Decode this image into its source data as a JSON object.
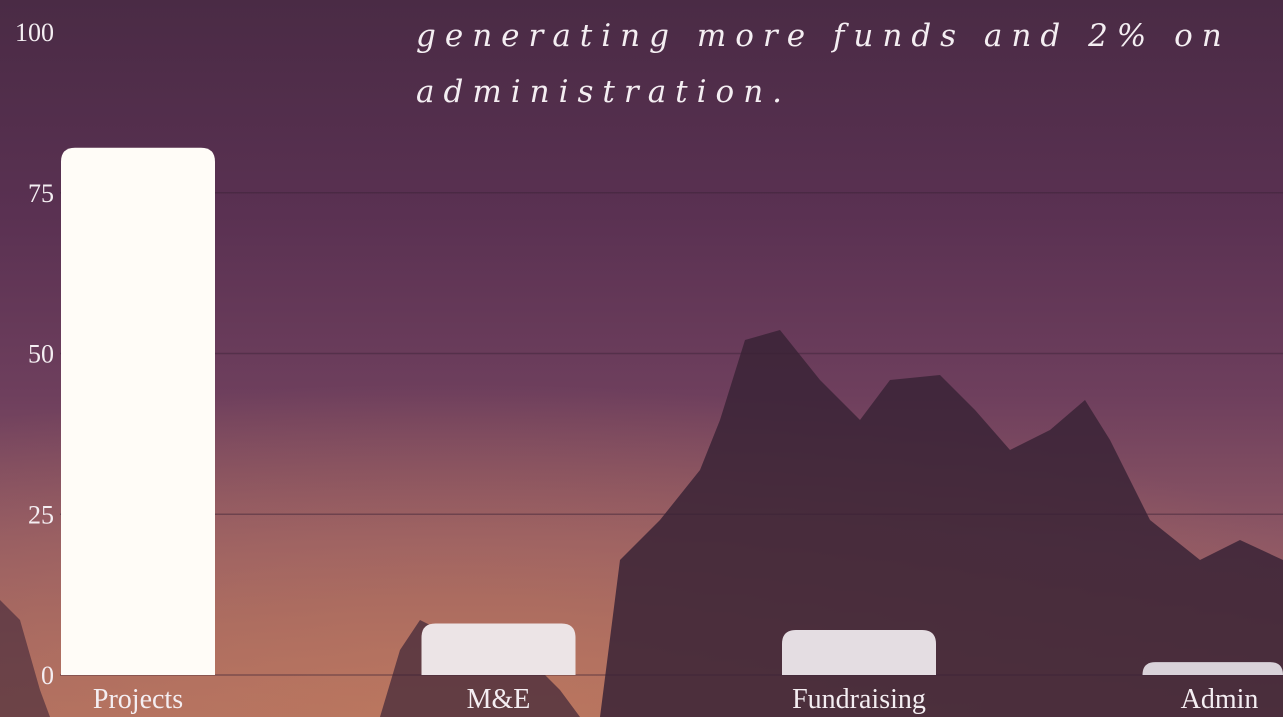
{
  "caption": {
    "line1": "generating more funds and 2% on",
    "line2": "administration."
  },
  "chart_data": {
    "type": "bar",
    "categories": [
      "Projects",
      "M&E",
      "Fundraising",
      "Admin"
    ],
    "values": [
      82,
      8,
      7,
      2
    ],
    "ylim": [
      0,
      100
    ],
    "yticks": [
      0,
      25,
      50,
      75,
      100
    ],
    "grid": true,
    "bar_colors": [
      "#fffcf7",
      "#ece4e6",
      "#e4dde2",
      "#d9d2d9"
    ]
  }
}
